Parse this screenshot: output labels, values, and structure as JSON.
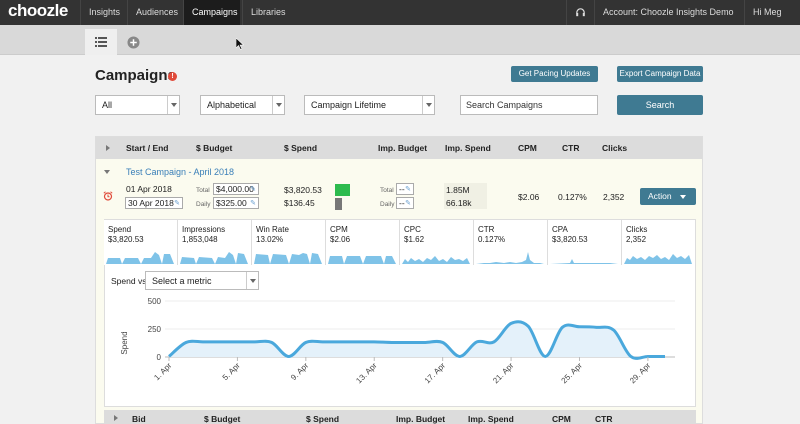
{
  "app": {
    "logo": "choozle",
    "nav": [
      {
        "label": "Insights",
        "active": false
      },
      {
        "label": "Audiences",
        "active": false
      },
      {
        "label": "Campaigns",
        "active": true
      },
      {
        "label": "Libraries",
        "active": false
      }
    ],
    "account": "Account: Choozle Insights Demo",
    "user": "Hi Meg"
  },
  "page": {
    "title": "Campaigns",
    "info_icon": "!",
    "buttons": {
      "pacing": "Get Pacing Updates",
      "export": "Export Campaign Data",
      "search": "Search"
    },
    "filters": {
      "status": "All",
      "sort": "Alphabetical",
      "range": "Campaign Lifetime",
      "search_placeholder": "Search Campaigns"
    }
  },
  "table": {
    "headers": [
      "Start / End",
      "$ Budget",
      "$ Spend",
      "Imp. Budget",
      "Imp. Spend",
      "CPM",
      "CTR",
      "Clicks"
    ],
    "campaign": {
      "name": "Test Campaign - April 2018",
      "start": "01 Apr 2018",
      "end": "30 Apr 2018",
      "total_label": "Total",
      "daily_label": "Daily",
      "budget_total": "$4,000.00",
      "budget_daily": "$325.00",
      "spend_total": "$3,820.53",
      "spend_daily": "$136.45",
      "imp_budget_total": "--",
      "imp_budget_daily": "--",
      "imp_spend_total": "1.85M",
      "imp_spend_daily": "66.18k",
      "cpm": "$2.06",
      "ctr": "0.127%",
      "clicks": "2,352",
      "action": "Action",
      "pacing_color_total": "#2dbb4e",
      "pacing_color_daily": "#777777"
    },
    "metrics": [
      {
        "name": "Spend",
        "value": "$3,820.53"
      },
      {
        "name": "Impressions",
        "value": "1,853,048"
      },
      {
        "name": "Win Rate",
        "value": "13.02%"
      },
      {
        "name": "CPM",
        "value": "$2.06"
      },
      {
        "name": "CPC",
        "value": "$1.62"
      },
      {
        "name": "CTR",
        "value": "0.127%"
      },
      {
        "name": "CPA",
        "value": "$3,820.53"
      },
      {
        "name": "Clicks",
        "value": "2,352"
      }
    ],
    "chart": {
      "compare_label": "Spend vs.",
      "compare_select": "Select a metric",
      "ylabel": "Spend",
      "yticks": [
        "500",
        "250",
        "0"
      ],
      "xticks": [
        "1. Apr",
        "5. Apr",
        "9. Apr",
        "13. Apr",
        "17. Apr",
        "21. Apr",
        "25. Apr",
        "29. Apr"
      ]
    },
    "bottom_headers": [
      "Bid",
      "$ Budget",
      "$ Spend",
      "Imp. Budget",
      "Imp. Spend",
      "CPM",
      "CTR"
    ]
  },
  "chart_data": {
    "type": "area",
    "xlabel": "",
    "ylabel": "Spend",
    "ylim": [
      0,
      500
    ],
    "x": [
      "1. Apr",
      "2. Apr",
      "3. Apr",
      "4. Apr",
      "5. Apr",
      "6. Apr",
      "7. Apr",
      "8. Apr",
      "9. Apr",
      "10. Apr",
      "11. Apr",
      "12. Apr",
      "13. Apr",
      "14. Apr",
      "15. Apr",
      "16. Apr",
      "17. Apr",
      "18. Apr",
      "19. Apr",
      "20. Apr",
      "21. Apr",
      "22. Apr",
      "23. Apr",
      "24. Apr",
      "25. Apr",
      "26. Apr",
      "27. Apr",
      "28. Apr",
      "29. Apr",
      "30. Apr"
    ],
    "series": [
      {
        "values": [
          5,
          130,
          135,
          135,
          135,
          135,
          130,
          5,
          130,
          135,
          135,
          135,
          135,
          130,
          130,
          130,
          130,
          5,
          135,
          135,
          300,
          275,
          5,
          265,
          270,
          265,
          240,
          5,
          5,
          5
        ]
      }
    ],
    "colors": {
      "line": "#4aa8dc",
      "fill": "#e4f1fa"
    }
  }
}
